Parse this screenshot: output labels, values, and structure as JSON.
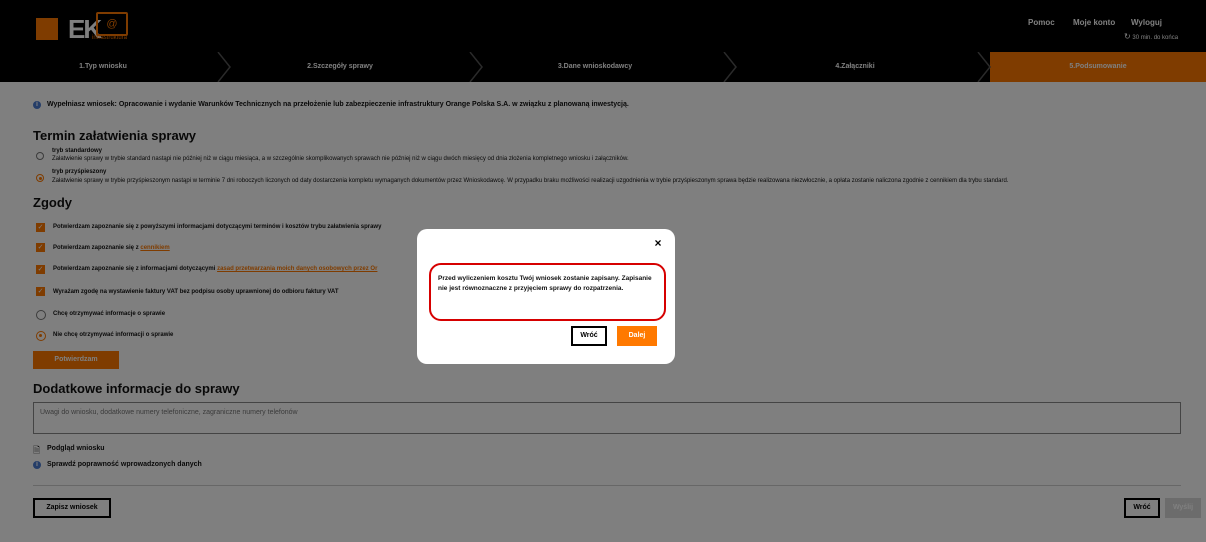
{
  "header": {
    "logo_text": "EK",
    "logo_sub": "infrastruktura",
    "help": "Pomoc",
    "account": "Moje konto",
    "logout": "Wyloguj",
    "timer": "30 min. do końca"
  },
  "steps": [
    {
      "label": "1.Typ wniosku"
    },
    {
      "label": "2.Szczegóły sprawy"
    },
    {
      "label": "3.Dane wnioskodawcy"
    },
    {
      "label": "4.Załączniki"
    },
    {
      "label": "5.Podsumowanie"
    }
  ],
  "info_line": "Wypełniasz wniosek: Opracowanie i wydanie Warunków Technicznych na przełożenie lub zabezpieczenie infrastruktury Orange Polska S.A. w związku z planowaną inwestycją.",
  "termin": {
    "title": "Termin załatwienia sprawy",
    "options": [
      {
        "label": "tryb standardowy",
        "desc": "Załatwienie sprawy w trybie standard nastąpi nie później niż w ciągu miesiąca, a w szczególnie skomplikowanych sprawach nie później niż w ciągu dwóch miesięcy od dnia złożenia kompletnego wniosku i załączników."
      },
      {
        "label": "tryb przyśpieszony",
        "desc": "Załatwienie sprawy w trybie przyśpieszonym nastąpi w terminie 7 dni roboczych liczonych od daty dostarczenia kompletu wymaganych dokumentów przez Wnioskodawcę. W przypadku braku możliwości realizacji uzgodnienia w trybie przyśpieszonym sprawa będzie realizowana niezwłocznie, a opłata zostanie naliczona zgodnie z cennikiem dla trybu standard."
      }
    ]
  },
  "zgody": {
    "title": "Zgody",
    "c1": "Potwierdzam zapoznanie się z powyższymi informacjami dotyczącymi terminów i kosztów trybu załatwienia sprawy",
    "c2_pre": "Potwierdzam zapoznanie się z",
    "c2_link": "cennikiem",
    "c3_pre": "Potwierdzam zapoznanie się z informacjami dotyczącymi",
    "c3_link": "zasad przetwarzania moich danych osobowych przez Or",
    "c4": "Wyrażam zgodę na wystawienie faktury VAT bez podpisu osoby uprawnionej do odbioru faktury VAT",
    "r1": "Chcę otrzymywać informacje o sprawie",
    "r2": "Nie chcę otrzymywać informacji o sprawie",
    "confirm": "Potwierdzam"
  },
  "dodatkowe": {
    "title": "Dodatkowe informacje do sprawy",
    "placeholder": "Uwagi do wniosku, dodatkowe numery telefoniczne, zagraniczne numery telefonów"
  },
  "links": {
    "preview": "Podgląd wniosku",
    "verify": "Sprawdź poprawność wprowadzonych danych"
  },
  "footer": {
    "save": "Zapisz wniosek",
    "back": "Wróć",
    "send": "Wyślij"
  },
  "modal": {
    "close": "×",
    "message": "Przed wyliczeniem kosztu Twój wniosek zostanie zapisany. Zapisanie nie jest równoznaczne z przyjęciem sprawy do rozpatrzenia.",
    "back": "Wróć",
    "next": "Dalej"
  },
  "colors": {
    "accent": "#ff7900",
    "topbar": "#000000",
    "info": "#4a7bd1",
    "highlight_border": "#d60000"
  }
}
